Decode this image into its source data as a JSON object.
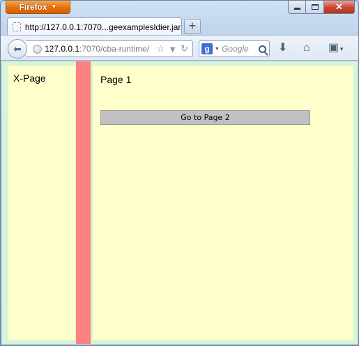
{
  "browser": {
    "menu_button": "Firefox",
    "tab_title": "http://127.0.0.1:7070...geexamplesldier.jar/",
    "url_host": "127.0.0.1",
    "url_rest": ":7070/cba-runtime/",
    "search_placeholder": "Google",
    "search_engine_letter": "g",
    "new_tab_symbol": "+",
    "close_symbol": "✕"
  },
  "page": {
    "left_label": "X-Page",
    "title": "Page 1",
    "button_label": "Go to Page 2"
  },
  "colors": {
    "pane_background": "#ffffcc",
    "splitter": "#ff8080",
    "frame": "#d6f5d6",
    "button": "#c0c0c0"
  }
}
